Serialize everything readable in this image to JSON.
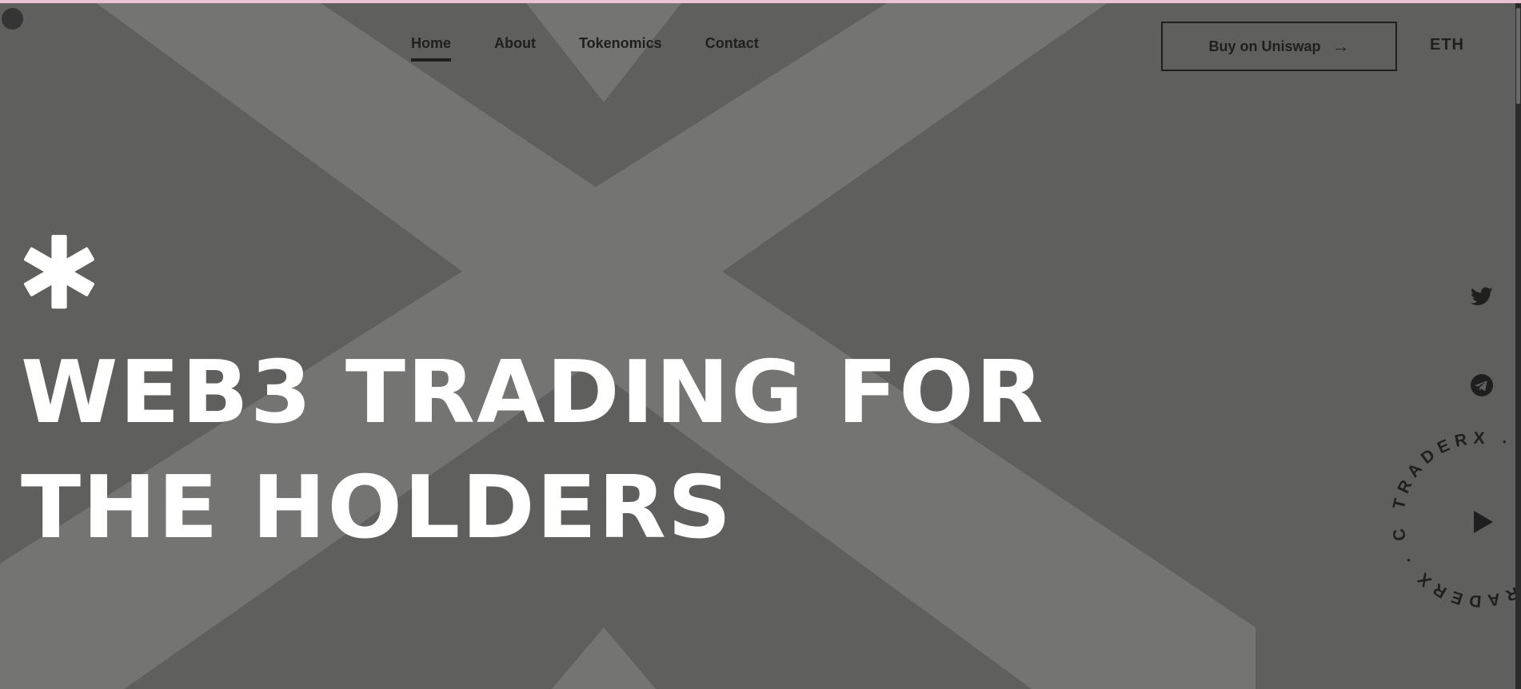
{
  "nav": {
    "items": [
      {
        "label": "Home",
        "active": true
      },
      {
        "label": "About",
        "active": false
      },
      {
        "label": "Tokenomics",
        "active": false
      },
      {
        "label": "Contact",
        "active": false
      }
    ]
  },
  "header": {
    "buy_label": "Buy on Uniswap",
    "buy_arrow": "→",
    "network": "ETH"
  },
  "hero": {
    "line1": "WEB3 TRADING FOR",
    "line2": "THE HOLDERS"
  },
  "social": {
    "icons": [
      "twitter-icon",
      "telegram-icon"
    ]
  },
  "badge": {
    "ring_text": "TRADERX · CAPITAL · TRADERX · CAPITAL ·",
    "icon": "play-icon"
  },
  "colors": {
    "background": "#5f5f5e",
    "x_shape": "#747473",
    "foreground": "#1f1f1f",
    "hero_text": "#ffffff",
    "top_line": "#e9c3d2"
  }
}
